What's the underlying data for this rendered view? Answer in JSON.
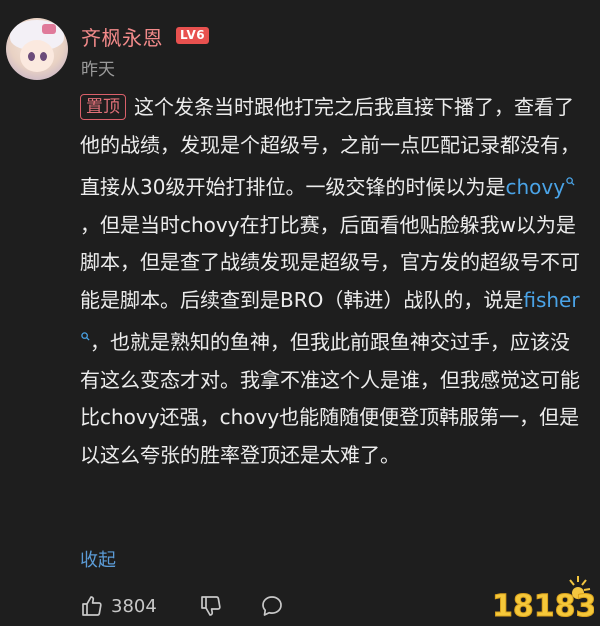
{
  "comment": {
    "username": "齐枫永恩",
    "level": "LV6",
    "timestamp": "昨天",
    "pin_label": "置顶",
    "text_1": "这个发条当时跟他打完之后我直接下播了，查看了他的战绩，发现是个超级号，之前一点匹配记录都没有，直接从30级开始打排位。一级交锋的时候以为是",
    "link_1": "chovy",
    "text_2": "，但是当时chovy在打比赛，后面看他贴脸躲我w以为是脚本，但是查了战绩发现是超级号，官方发的超级号不可能是脚本。后续查到是BRO（韩进）战队的，说是",
    "link_2": "fisher",
    "text_3": "，也就是熟知的鱼神，但我此前跟鱼神交过手，应该没有这么变态才对。我拿不准这个人是谁，但我感觉这可能比chovy还强，chovy也能随随便便登顶韩服第一，但是以这么夸张的胜率登顶还是太难了。",
    "collapse_label": "收起",
    "like_count": "3804"
  },
  "icons": {
    "search_hint": "magnifier-icon",
    "like": "thumbs-up-icon",
    "dislike": "thumbs-down-icon",
    "reply": "comment-bubble-icon"
  },
  "watermark": {
    "text": "18183"
  },
  "colors": {
    "background": "#1e1e1e",
    "username": "#f28a8a",
    "level_badge": "#e8514f",
    "link": "#4aa3e6",
    "pin_border": "#d9606a"
  }
}
